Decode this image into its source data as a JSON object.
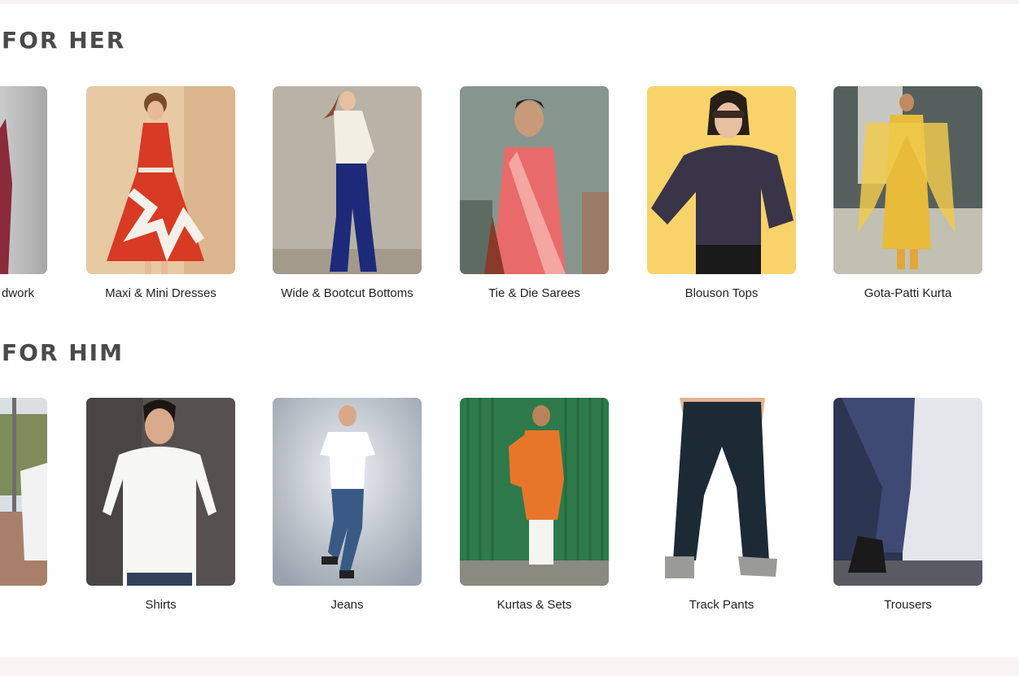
{
  "sections": {
    "her": {
      "title": "FOR HER",
      "items": [
        {
          "label": "dwork",
          "partial": true,
          "icon": "photo-fabric-icon"
        },
        {
          "label": "Maxi & Mini Dresses",
          "icon": "photo-dress-icon"
        },
        {
          "label": "Wide & Bootcut Bottoms",
          "icon": "photo-bootcut-icon"
        },
        {
          "label": "Tie & Die Sarees",
          "icon": "photo-saree-icon"
        },
        {
          "label": "Blouson Tops",
          "icon": "photo-top-icon"
        },
        {
          "label": "Gota-Patti Kurta",
          "icon": "photo-kurta-icon"
        }
      ]
    },
    "him": {
      "title": "FOR HIM",
      "items": [
        {
          "label": "",
          "partial": true,
          "icon": "photo-outdoor-icon"
        },
        {
          "label": "Shirts",
          "icon": "photo-shirt-icon"
        },
        {
          "label": "Jeans",
          "icon": "photo-jeans-icon"
        },
        {
          "label": "Kurtas & Sets",
          "icon": "photo-kurta-set-icon"
        },
        {
          "label": "Track Pants",
          "icon": "photo-trackpants-icon"
        },
        {
          "label": "Trousers",
          "icon": "photo-trousers-icon"
        }
      ]
    }
  },
  "colors": {
    "title": "#4a4a4a",
    "page_bg": "#ffffff",
    "footer_strip": "#f8f4f3"
  }
}
